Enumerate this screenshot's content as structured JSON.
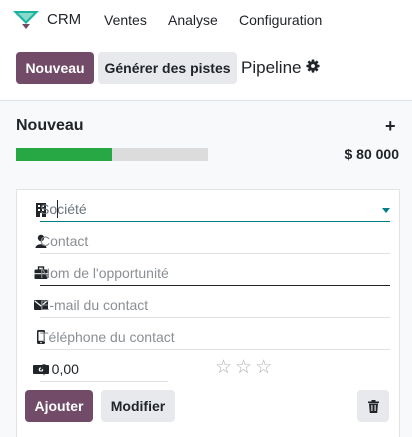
{
  "topbar": {
    "app_name": "CRM",
    "menu": [
      "Ventes",
      "Analyse",
      "Configuration"
    ]
  },
  "control_panel": {
    "new_button": "Nouveau",
    "generate_button": "Générer des pistes",
    "view_title": "Pipeline"
  },
  "column": {
    "title": "Nouveau",
    "amount": "$ 80 000",
    "progress_won_fraction": 0.5
  },
  "quick_create": {
    "company_placeholder": "Société",
    "contact_placeholder": "Contact",
    "opportunity_placeholder": "Nom de l'opportunité",
    "email_placeholder": "E-mail du contact",
    "phone_placeholder": "Téléphone du contact",
    "revenue_value": "$ 0,00",
    "priority_stars": 0,
    "add_button": "Ajouter",
    "edit_button": "Modifier"
  },
  "colors": {
    "primary": "#714B67",
    "progress_fill": "#28a745",
    "focus_line": "#017e84"
  }
}
